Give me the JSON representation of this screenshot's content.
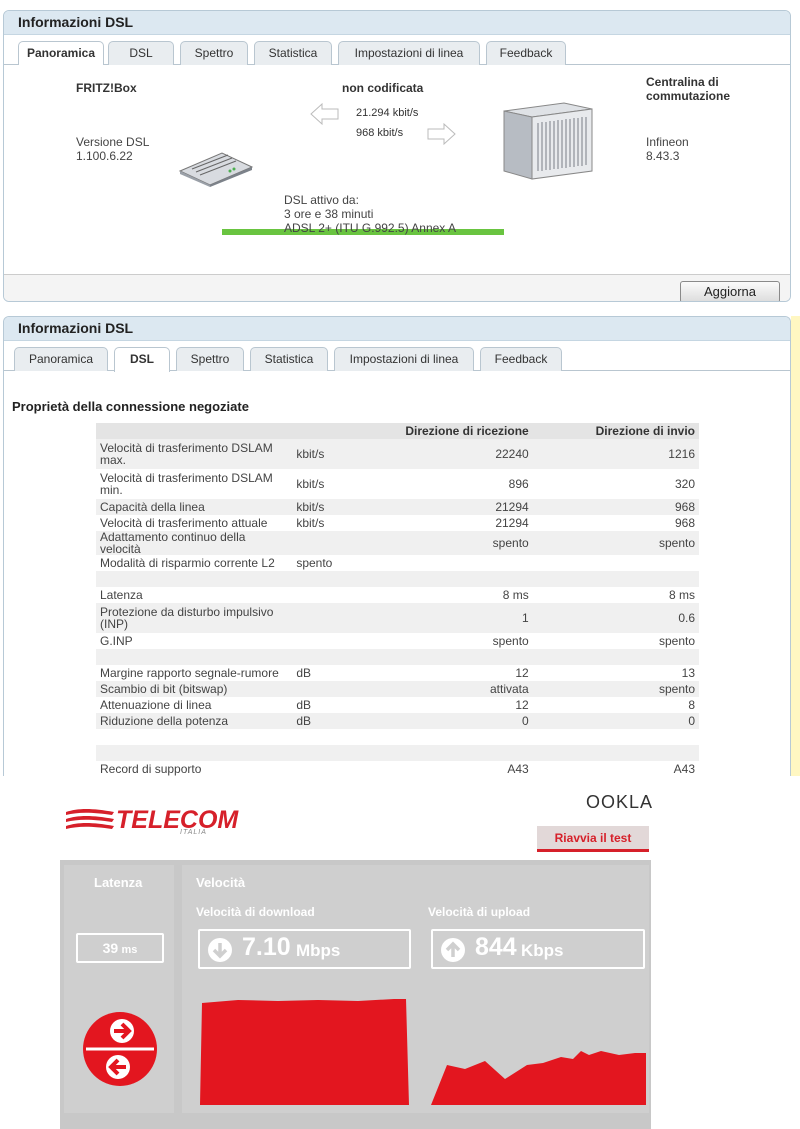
{
  "overview_panel": {
    "title": "Informazioni DSL",
    "tabs": [
      "Panoramica",
      "DSL",
      "Spettro",
      "Statistica",
      "Impostazioni di linea",
      "Feedback"
    ],
    "active_tab": "Panoramica",
    "device_label": "FRITZ!Box",
    "device_version_label": "Versione DSL",
    "device_version": "1.100.6.22",
    "encoding": "non codificata",
    "downstream": "21.294 kbit/s",
    "upstream": "968 kbit/s",
    "exchange_label": "Centralina di commutazione",
    "exchange_vendor": "Infineon",
    "exchange_version": "8.43.3",
    "active_since_label": "DSL attivo da:",
    "active_since": "3 ore e 38 minuti",
    "mode": "ADSL 2+ (ITU G.992.5) Annex A",
    "refresh_button": "Aggiorna"
  },
  "dsl_panel": {
    "title": "Informazioni DSL",
    "tabs": [
      "Panoramica",
      "DSL",
      "Spettro",
      "Statistica",
      "Impostazioni di linea",
      "Feedback"
    ],
    "active_tab": "DSL",
    "section_title": "Proprietà della connessione negoziate",
    "columns": [
      "",
      "",
      "Direzione di ricezione",
      "Direzione di invio"
    ],
    "rows": [
      {
        "name": "Velocità di trasferimento DSLAM max.",
        "unit": "kbit/s",
        "rx": "22240",
        "tx": "1216",
        "tall": true
      },
      {
        "name": "Velocità di trasferimento DSLAM min.",
        "unit": "kbit/s",
        "rx": "896",
        "tx": "320",
        "tall": true
      },
      {
        "name": "Capacità della linea",
        "unit": "kbit/s",
        "rx": "21294",
        "tx": "968"
      },
      {
        "name": "Velocità di trasferimento attuale",
        "unit": "kbit/s",
        "rx": "21294",
        "tx": "968"
      },
      {
        "name": "Adattamento continuo della velocità",
        "unit": "",
        "rx": "spento",
        "tx": "spento"
      },
      {
        "name": "Modalità di risparmio corrente L2",
        "unit": "spento",
        "rx": "",
        "tx": ""
      },
      {
        "name": "",
        "unit": "",
        "rx": "",
        "tx": ""
      },
      {
        "name": "Latenza",
        "unit": "",
        "rx": "8 ms",
        "tx": "8 ms"
      },
      {
        "name": "Protezione da disturbo impulsivo (INP)",
        "unit": "",
        "rx": "1",
        "tx": "0.6",
        "tall": true
      },
      {
        "name": "G.INP",
        "unit": "",
        "rx": "spento",
        "tx": "spento"
      },
      {
        "name": "",
        "unit": "",
        "rx": "",
        "tx": ""
      },
      {
        "name": "Margine rapporto segnale-rumore",
        "unit": "dB",
        "rx": "12",
        "tx": "13"
      },
      {
        "name": "Scambio di bit (bitswap)",
        "unit": "",
        "rx": "attivata",
        "tx": "spento"
      },
      {
        "name": "Attenuazione di linea",
        "unit": "dB",
        "rx": "12",
        "tx": "8"
      },
      {
        "name": "Riduzione della potenza",
        "unit": "dB",
        "rx": "0",
        "tx": "0"
      },
      {
        "name": "",
        "unit": "",
        "rx": "",
        "tx": ""
      },
      {
        "name": "",
        "unit": "",
        "rx": "",
        "tx": ""
      },
      {
        "name": "Record di supporto",
        "unit": "",
        "rx": "A43",
        "tx": "A43"
      }
    ]
  },
  "speedtest": {
    "brand": "TELECOM",
    "brand_sub": "ITALIA",
    "provider": "OOKLA",
    "restart_button": "Riavvia il test",
    "latency_label": "Latenza",
    "latency_value": "39",
    "latency_unit": "ms",
    "speed_label": "Velocità",
    "download_label": "Velocità di download",
    "download_value": "7.10",
    "download_unit": "Mbps",
    "upload_label": "Velocità di upload",
    "upload_value": "844",
    "upload_unit": "Kbps",
    "accent_color": "#e3161f"
  }
}
